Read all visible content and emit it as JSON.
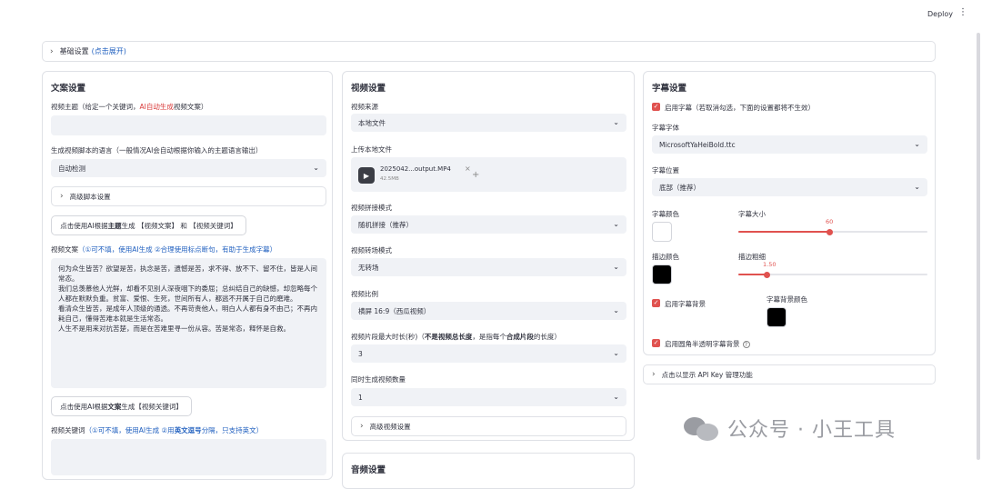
{
  "header": {
    "deploy_label": "Deploy",
    "menu_icon": "⋮"
  },
  "basic_settings": {
    "label": "基础设置",
    "hint": "(点击展开)"
  },
  "script_panel": {
    "title": "文案设置",
    "subject_label_a": "视频主题（给定一个关键词，",
    "subject_label_b": "AI自动生成",
    "subject_label_c": "视频文案）",
    "subject_value": "",
    "language_label": "生成视频脚本的语言（一般情况AI会自动根据你输入的主题语言输出）",
    "language_value": "自动检测",
    "advanced_script": "高级脚本设置",
    "gen_script_btn_a": "点击使用AI根据",
    "gen_script_btn_b": "主题",
    "gen_script_btn_c": "生成 【视频文案】 和 【视频关键词】",
    "script_label_a": "视频文案",
    "script_label_b": "（①可不填，使用AI生成 ②合理使用标点断句，有助于生成字幕）",
    "script_lines": [
      "何为众生皆苦？欲望是苦，执念是苦，遗憾是苦，求不得、放不下、留不住，皆是人间常态。",
      "我们总羡慕他人光鲜，却看不见别人深夜咽下的委屈；总纠结自己的缺憾，却忽略每个人都在默默负重。贫富、爱恨、生死，世间所有人，都逃不开属于自己的磨难。",
      "看清众生皆苦，是成年人顶级的通透。不再苛责他人，明白人人都有身不由己；不再内耗自己，懂得苦难本就是生活常态。",
      "人生不是用来对抗苦楚，而是在苦难里寻一份从容。苦是常态，释怀是自救。"
    ],
    "gen_keywords_btn_a": "点击使用AI根据",
    "gen_keywords_btn_b": "文案",
    "gen_keywords_btn_c": "生成【视频关键词】",
    "keywords_label_a": "视频关键词",
    "keywords_label_b": "（①可不填，使用AI生成 ②用",
    "keywords_label_c": "英文逗号",
    "keywords_label_d": "分隔，只支持英文）"
  },
  "video_panel": {
    "title": "视频设置",
    "source_label": "视频来源",
    "source_value": "本地文件",
    "upload_label": "上传本地文件",
    "file_name": "2025042...output.MP4",
    "file_size": "42.5MB",
    "add_symbol": "+",
    "concat_label": "视频拼接模式",
    "concat_value": "随机拼接（推荐）",
    "transition_label": "视频转场模式",
    "transition_value": "无转场",
    "aspect_label": "视频比例",
    "aspect_value": "横屏 16:9（西瓜视频）",
    "clip_label_a": "视频片段最大时长(秒)（",
    "clip_label_b": "不是视频总长度",
    "clip_label_c": "，是指每个",
    "clip_label_d": "合成片段",
    "clip_label_e": "的长度）",
    "clip_value": "3",
    "count_label": "同时生成视频数量",
    "count_value": "1",
    "advanced_video": "高级视频设置"
  },
  "audio_panel": {
    "title": "音频设置"
  },
  "subtitle_panel": {
    "title": "字幕设置",
    "enable_label": "启用字幕（若取消勾选，下面的设置都将不生效）",
    "font_label": "字幕字体",
    "font_value": "MicrosoftYaHeiBold.ttc",
    "position_label": "字幕位置",
    "position_value": "底部（推荐）",
    "color_label": "字幕颜色",
    "color_value": "#ffffff",
    "size_label": "字幕大小",
    "size_value": "60",
    "size_fraction": 0.48,
    "stroke_color_label": "描边颜色",
    "stroke_color_value": "#000000",
    "stroke_width_label": "描边粗细",
    "stroke_width_value": "1.50",
    "stroke_fraction": 0.15,
    "bg_enable_label": "启用字幕背景",
    "bg_color_label": "字幕背景颜色",
    "bg_color_value": "#000000",
    "rounded_label": "启用圆角半透明字幕背景"
  },
  "api_key": {
    "label": "点击以显示 API Key 管理功能"
  },
  "watermark": {
    "text": "公众号 · 小王工具"
  },
  "colors": {
    "accent": "#e0524f",
    "link": "#1f5fbf"
  }
}
